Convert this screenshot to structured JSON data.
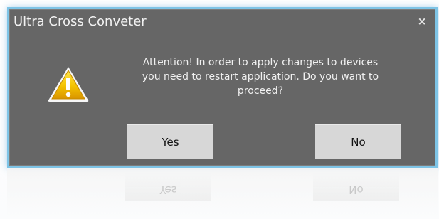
{
  "dialog": {
    "title": "Ultra Cross Conveter",
    "close_glyph": "×",
    "message": "Attention! In order to apply changes to devices\nyou need to restart application. Do you want to\nproceed?",
    "icon": "warning-triangle-icon",
    "buttons": {
      "yes": "Yes",
      "no": "No"
    }
  },
  "colors": {
    "dialog_bg": "#666666",
    "border": "#7ec4e6",
    "button_bg": "#d7d7d7",
    "text": "#f0f0f0",
    "warning_yellow": "#f2c200"
  }
}
